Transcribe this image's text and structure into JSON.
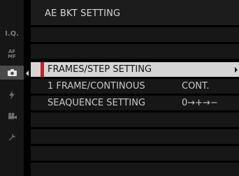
{
  "header": {
    "title": "AE BKT SETTING"
  },
  "sidebar": {
    "tabs": [
      {
        "name": "image-quality-tab",
        "text": "I.Q."
      },
      {
        "name": "af-mf-tab",
        "text": "AF MF"
      },
      {
        "name": "shooting-settings-tab",
        "icon": "camera-icon"
      },
      {
        "name": "flash-tab",
        "icon": "flash-icon"
      },
      {
        "name": "movie-tab",
        "icon": "movie-icon"
      },
      {
        "name": "setup-tab",
        "icon": "wrench-icon"
      }
    ]
  },
  "menu": {
    "items": [
      {
        "label": "FRAMES/STEP SETTING",
        "value": "",
        "selected": true
      },
      {
        "label": "1 FRAME/CONTINOUS",
        "value": "CONT."
      },
      {
        "label": "SEAQUENCE SETTING",
        "value": "0→+→−"
      }
    ]
  },
  "colors": {
    "accent": "#c8202a",
    "selected_bg": "#d5d5d5",
    "row_bg": "#171717"
  }
}
